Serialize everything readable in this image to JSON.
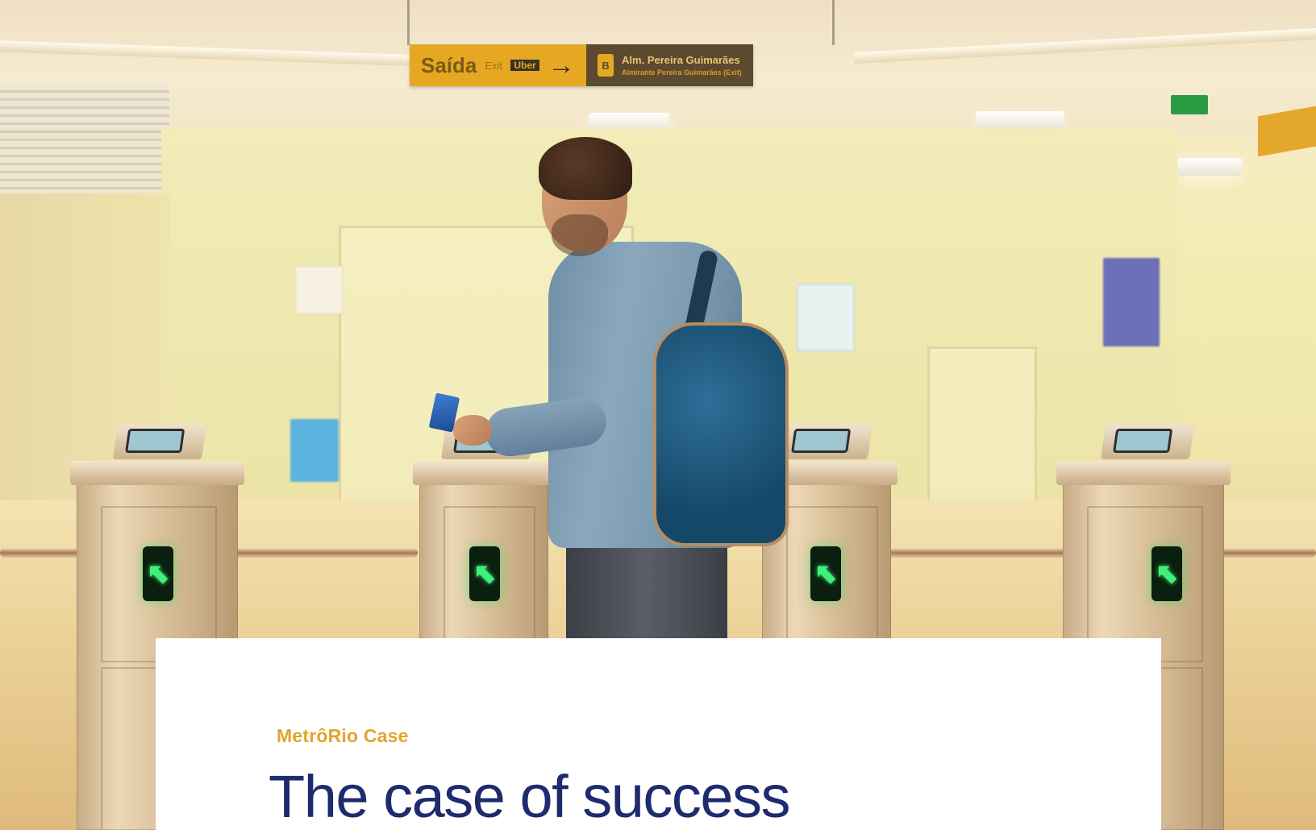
{
  "signage": {
    "exit_word": "Saída",
    "exit_sub": "Exit",
    "exit_badge": "Uber",
    "arrow": "→",
    "station_number": "B",
    "station_line1": "Alm. Pereira Guimarães",
    "station_line2": "Almirante Pereira Guimarães (Exit)"
  },
  "hero": {
    "turnstile_arrow_glyph": "⬉",
    "accent_green": "#41f07a",
    "sign_yellow": "#e6a823"
  },
  "content": {
    "eyebrow": "MetrôRio Case",
    "headline": "The case of success",
    "eyebrow_color": "#e0a52b",
    "headline_color": "#1e2b6e"
  }
}
